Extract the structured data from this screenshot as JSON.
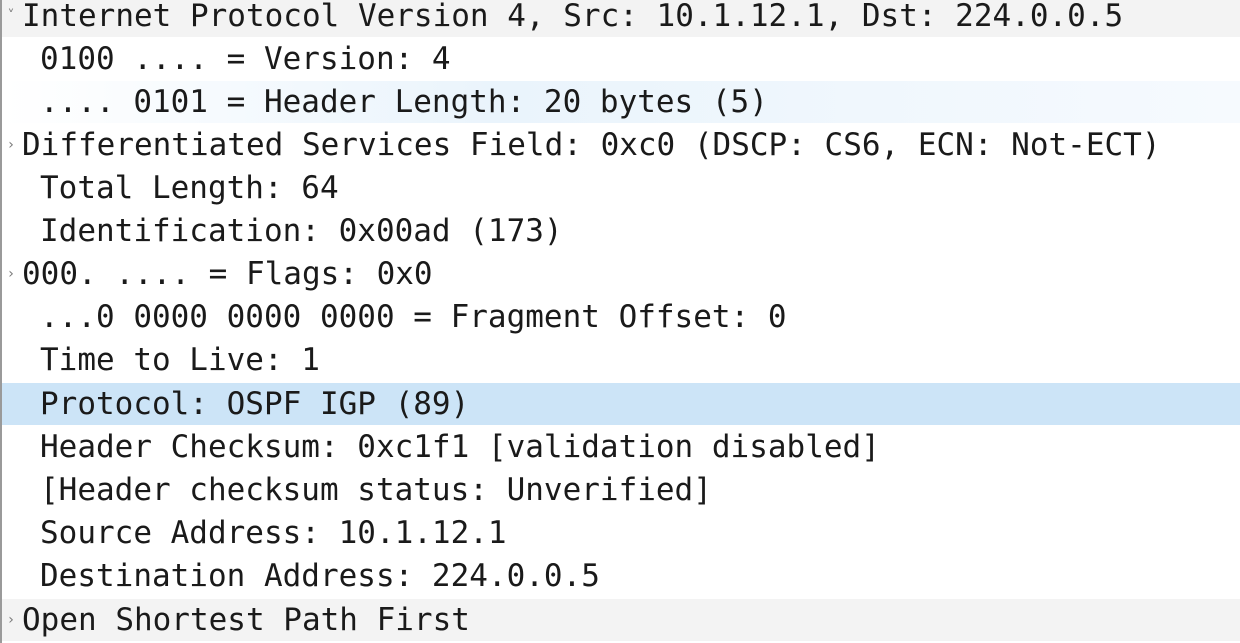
{
  "tree": {
    "ip_header": {
      "label": "Internet Protocol Version 4, Src: 10.1.12.1, Dst: 224.0.0.5",
      "expander": "˅",
      "expander_icon": "chevron-down-icon"
    },
    "fields": [
      {
        "label": "0100 .... = Version: 4",
        "expander": ""
      },
      {
        "label": ".... 0101 = Header Length: 20 bytes (5)",
        "expander": ""
      },
      {
        "label": "Differentiated Services Field: 0xc0 (DSCP: CS6, ECN: Not-ECT)",
        "expander": "›"
      },
      {
        "label": "Total Length: 64",
        "expander": ""
      },
      {
        "label": "Identification: 0x00ad (173)",
        "expander": ""
      },
      {
        "label": "000. .... = Flags: 0x0",
        "expander": "›"
      },
      {
        "label": "...0 0000 0000 0000 = Fragment Offset: 0",
        "expander": ""
      },
      {
        "label": "Time to Live: 1",
        "expander": ""
      },
      {
        "label": "Protocol: OSPF IGP (89)",
        "expander": ""
      },
      {
        "label": "Header Checksum: 0xc1f1 [validation disabled]",
        "expander": ""
      },
      {
        "label": "[Header checksum status: Unverified]",
        "expander": ""
      },
      {
        "label": "Source Address: 10.1.12.1",
        "expander": ""
      },
      {
        "label": "Destination Address: 224.0.0.5",
        "expander": ""
      }
    ],
    "ospf_header": {
      "label": "Open Shortest Path First",
      "expander": "›",
      "expander_icon": "chevron-right-icon"
    },
    "colors": {
      "selected_row": "#cce4f7",
      "section_row": "#f3f3f3",
      "text": "#1a1a1a"
    }
  }
}
